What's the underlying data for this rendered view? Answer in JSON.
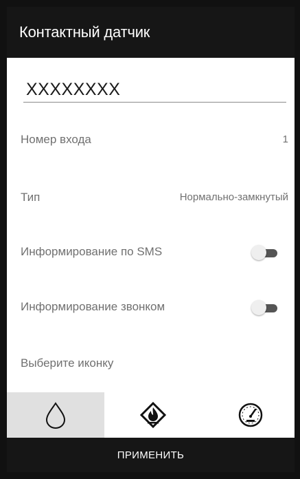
{
  "dialog": {
    "title": "Контактный датчик",
    "name_value": "XXXXXXXX"
  },
  "rows": {
    "input_number": {
      "label": "Номер входа",
      "value": "1"
    },
    "type": {
      "label": "Тип",
      "value": "Нормально-замкнутый"
    },
    "sms": {
      "label": "Информирование по SMS",
      "enabled": false
    },
    "call": {
      "label": "Информирование звонком",
      "enabled": false
    },
    "icon_choice": {
      "label": "Выберите иконку"
    }
  },
  "icons": [
    {
      "name": "water-drop-icon",
      "selected": true
    },
    {
      "name": "fire-hazard-icon",
      "selected": false
    },
    {
      "name": "gauge-icon",
      "selected": false
    }
  ],
  "apply_label": "ПРИМЕНИТЬ",
  "colors": {
    "title_bar": "#161616",
    "background": "#ffffff",
    "label_text": "#707070",
    "toggle_off_track": "#555555",
    "selected_icon_bg": "#e0e0e0"
  }
}
